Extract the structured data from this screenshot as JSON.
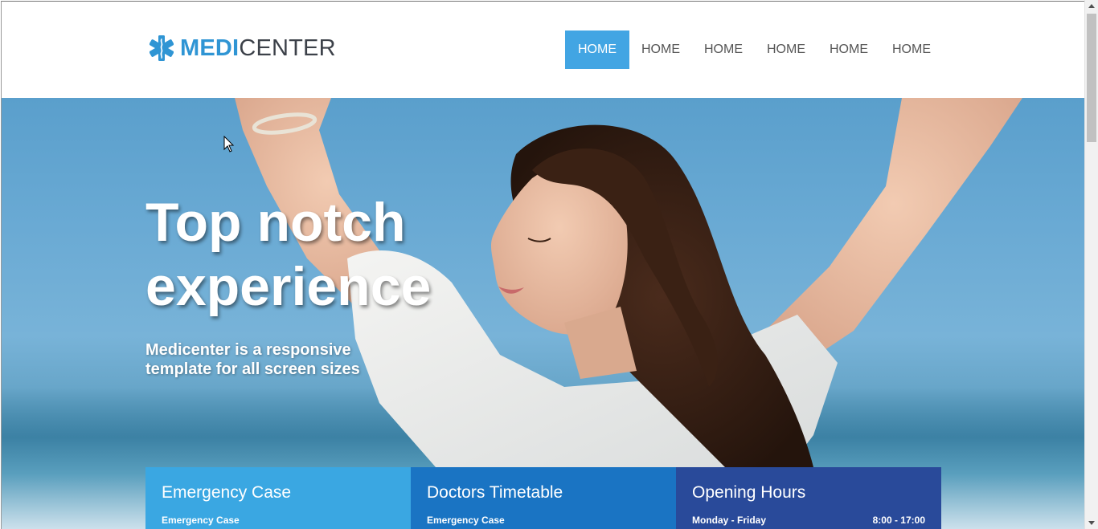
{
  "logo": {
    "part1": "MEDI",
    "part2": "CENTER"
  },
  "nav": {
    "items": [
      {
        "label": "HOME",
        "active": true
      },
      {
        "label": "HOME",
        "active": false
      },
      {
        "label": "HOME",
        "active": false
      },
      {
        "label": "HOME",
        "active": false
      },
      {
        "label": "HOME",
        "active": false
      },
      {
        "label": "HOME",
        "active": false
      }
    ]
  },
  "hero": {
    "title": "Top notch experience",
    "subtitle": "Medicenter is a responsive template for all screen sizes"
  },
  "boxes": [
    {
      "title": "Emergency Case",
      "line_left": "Emergency Case",
      "line_right": "",
      "color": "#3aa7e2"
    },
    {
      "title": "Doctors Timetable",
      "line_left": "Emergency Case",
      "line_right": "",
      "color": "#1a74c3"
    },
    {
      "title": "Opening Hours",
      "line_left": "Monday - Friday",
      "line_right": "8:00 - 17:00",
      "color": "#294a9a"
    }
  ],
  "colors": {
    "brand": "#2f95d4",
    "nav_active": "#42a5e3"
  },
  "icons": {
    "logo": "star-of-life-icon",
    "cursor": "mouse-cursor-icon"
  }
}
